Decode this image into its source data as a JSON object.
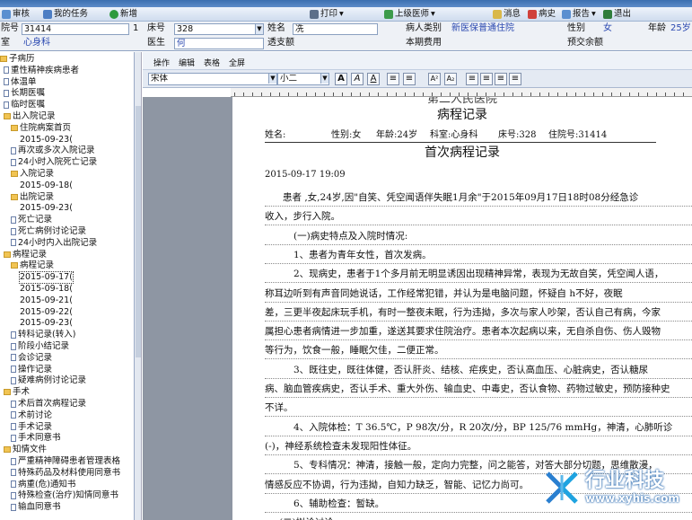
{
  "toolbar": {
    "review": "审核",
    "my_tasks": "我的任务",
    "new": "新增",
    "print": "打印",
    "senior_doctor": "上级医师",
    "message": "消息",
    "history": "病史",
    "report": "报告",
    "exit": "退出"
  },
  "patient": {
    "bed_number_label": "院号",
    "bed_number_value": "31414",
    "page_count": "1",
    "bed_label": "床号",
    "bed_value": "328",
    "name_label": "姓名",
    "name_value": "冼",
    "category_label": "病人类别",
    "category_value": "新医保普通住院",
    "gender_label": "性别",
    "gender_value": "女",
    "age_label": "年龄",
    "age_value": "25岁",
    "dept_label": "室",
    "dept_value": "心身科",
    "doctor_label": "医生",
    "doctor_value": "何",
    "prepaid_label": "透支额",
    "this_period_label": "本期费用",
    "balance_label": "预交余额"
  },
  "sidebar": {
    "items": [
      "子病历",
      "重性精神疾病患者",
      "体温单",
      "长期医嘱",
      "临时医嘱",
      "出入院记录",
      "住院病案首页",
      "2015-09-23(",
      "再次或多次入院记录",
      "24小时入院死亡记录",
      "入院记录",
      "2015-09-18(",
      "出院记录",
      "2015-09-23(",
      "死亡记录",
      "死亡病例讨论记录",
      "24小时内入出院记录",
      "病程记录",
      "病程记录",
      "2015-09-17(",
      "2015-09-18(",
      "2015-09-21(",
      "2015-09-22(",
      "2015-09-23(",
      "转科记录(转入)",
      "阶段小结记录",
      "会诊记录",
      "操作记录",
      "疑难病例讨论记录",
      "手术",
      "术后首次病程记录",
      "术前讨论",
      "手术记录",
      "手术同意书",
      "知情文件",
      "严重精神障碍患者管理表格",
      "特殊药品及材料使用同意书",
      "病重(危)通知书",
      "特殊检查(治疗)知情同意书",
      "输血同意书"
    ]
  },
  "editor": {
    "menu": [
      "操作",
      "编辑",
      "表格",
      "全屏"
    ],
    "font_name": "宋体",
    "font_size": "小二"
  },
  "document": {
    "hospital_partial": "第二人民医院",
    "title": "病程记录",
    "header_name": "姓名:",
    "header_gender": "性别:女",
    "header_age": "年龄:24岁",
    "header_dept": "科室:心身科",
    "header_bed": "床号:328",
    "header_admission": "住院号:31414",
    "section_title": "首次病程记录",
    "datetime": "2015-09-17 19:09",
    "lines": [
      "患者      ,女,24岁,因\"自笑、凭空闻语伴失眠1月余\"于2015年09月17日18时08分经急诊",
      "收入，步行入院。",
      "(一)病史特点及入院时情况:",
      "1、患者为青年女性，首次发病。",
      "2、现病史，患者于1个多月前无明显诱因出现精神异常，表现为无故自笑，凭空闻人语，",
      "称耳边听到有声音同她说话，工作经常犯错，并认为是电脑问题，怀疑自        h不好，夜眠",
      "差，三更半夜起床玩手机，有时一整夜未眠，行为违拗，多次与家人吵架，否认自己有病，今家",
      "属担心患者病情进一步加重，遂送其要求住院治疗。患者本次起病以来，无自杀自伤、伤人毁物",
      "等行为，饮食一般，睡眠欠佳，二便正常。",
      "3、既往史，既往体健，否认肝炎、结核、疟疾史，否认高血压、心脏病史，否认糖尿",
      "病、脑血管疾病史，否认手术、重大外伤、输血史、中毒史，否认食物、药物过敏史，预防接种史",
      "不详。",
      "4、入院体检：T 36.5℃，P 98次/分，R 20次/分，BP 125/76 mmHg，神清，心肺听诊",
      "(-)，神经系统检查未发现阳性体征。",
      "5、专科情况：神清，接触一般，定向力完整，问之能答，对答大部分切题，思维散漫，",
      "情感反应不协调，行为违拗，自知力缺乏，智能、记忆力尚可。",
      "6、辅助检查：暂缺。",
      "(二)拟诊讨论:"
    ]
  },
  "watermark": {
    "brand": "行业科技",
    "url": "www.xyhis.com"
  }
}
